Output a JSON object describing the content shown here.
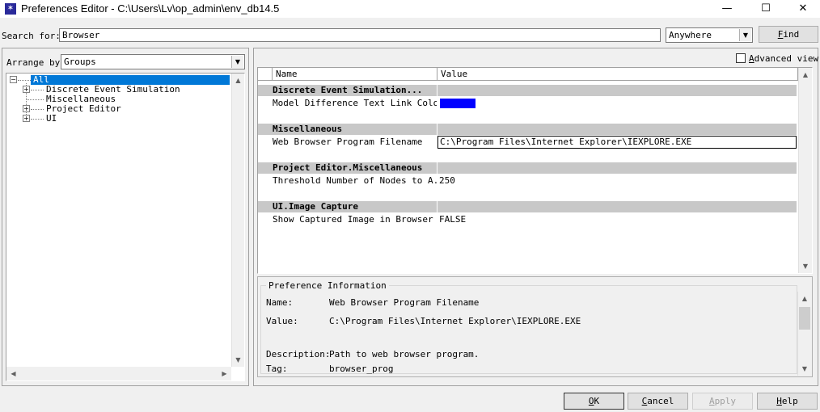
{
  "window": {
    "title": "Preferences Editor - C:\\Users\\Lv\\op_admin\\env_db14.5",
    "app_icon": "star-icon",
    "minimize_glyph": "—",
    "maximize_glyph": "☐",
    "close_glyph": "✕"
  },
  "search": {
    "label": "Search for:",
    "value": "Browser",
    "scope": "Anywhere",
    "find_prefix": "F",
    "find_rest": "ind"
  },
  "arrange": {
    "label": "Arrange by",
    "value": "Groups"
  },
  "tree": {
    "items": [
      {
        "label": "All",
        "selected": true
      },
      {
        "label": "Discrete Event Simulation"
      },
      {
        "label": "Miscellaneous"
      },
      {
        "label": "Project Editor"
      },
      {
        "label": "UI"
      }
    ]
  },
  "advanced_view": {
    "label_prefix": "A",
    "label_rest": "dvanced view",
    "checked": false
  },
  "grid": {
    "headers": {
      "name": "Name",
      "value": "Value"
    },
    "rows": [
      {
        "kind": "group",
        "name": "Discrete Event Simulation...",
        "value": ""
      },
      {
        "kind": "item",
        "name": "Model Difference Text Link Color",
        "value": "",
        "swatch": "#0000ff"
      },
      {
        "kind": "blank"
      },
      {
        "kind": "group",
        "name": "Miscellaneous",
        "value": ""
      },
      {
        "kind": "item",
        "name": "Web Browser Program Filename",
        "value": "C:\\Program Files\\Internet Explorer\\IEXPLORE.EXE",
        "selected": true
      },
      {
        "kind": "blank"
      },
      {
        "kind": "group",
        "name": "Project Editor.Miscellaneous",
        "value": ""
      },
      {
        "kind": "item",
        "name": "Threshold Number of Nodes to A...",
        "value": "250"
      },
      {
        "kind": "blank"
      },
      {
        "kind": "group",
        "name": "UI.Image Capture",
        "value": ""
      },
      {
        "kind": "item",
        "name": "Show Captured Image in Browser",
        "value": "FALSE"
      }
    ]
  },
  "info": {
    "title": "Preference Information",
    "name_label": "Name:",
    "name_value": "Web Browser Program Filename",
    "value_label": "Value:",
    "value_value": "C:\\Program Files\\Internet Explorer\\IEXPLORE.EXE",
    "desc_label": "Description:",
    "desc_value": "Path to web browser program.",
    "tag_label": "Tag:",
    "tag_value": "browser_prog"
  },
  "buttons": {
    "ok_prefix": "O",
    "ok_rest": "K",
    "cancel_prefix": "C",
    "cancel_rest": "ancel",
    "apply_prefix": "A",
    "apply_rest": "pply",
    "help_prefix": "H",
    "help_rest": "elp"
  },
  "colors": {
    "selection": "#0078d7",
    "group_band": "#c8c8c8",
    "swatch": "#0000ff"
  }
}
